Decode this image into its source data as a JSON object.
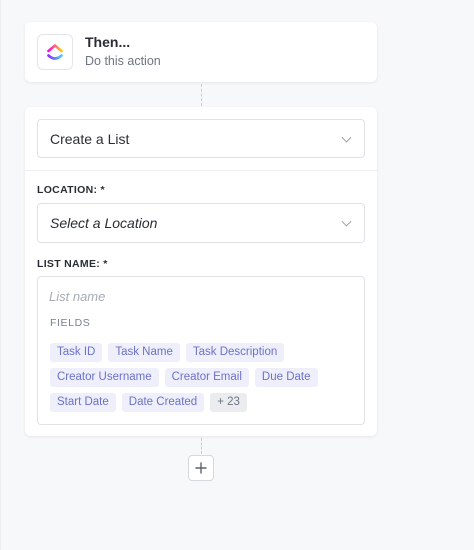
{
  "then_step": {
    "title": "Then...",
    "subtitle": "Do this action",
    "app_icon": "clickup-logo-icon"
  },
  "action": {
    "selected_action": "Create a List",
    "location": {
      "label": "LOCATION: *",
      "placeholder": "Select a Location"
    },
    "list_name": {
      "label": "LIST NAME: *",
      "placeholder": "List name",
      "value": ""
    },
    "fields": {
      "heading": "FIELDS",
      "rows": [
        [
          "Task ID",
          "Task Name",
          "Task Description"
        ],
        [
          "Creator Username",
          "Creator Email",
          "Due Date"
        ],
        [
          "Start Date",
          "Date Created"
        ]
      ],
      "more": "+ 23"
    }
  },
  "add_step": {
    "icon": "plus-icon"
  },
  "colors": {
    "chip_bg": "#eeeffb",
    "chip_text": "#6b72c9",
    "logo_purple": "#7b68ee",
    "logo_pink": "#fd71af",
    "logo_orange": "#ffa12f"
  }
}
